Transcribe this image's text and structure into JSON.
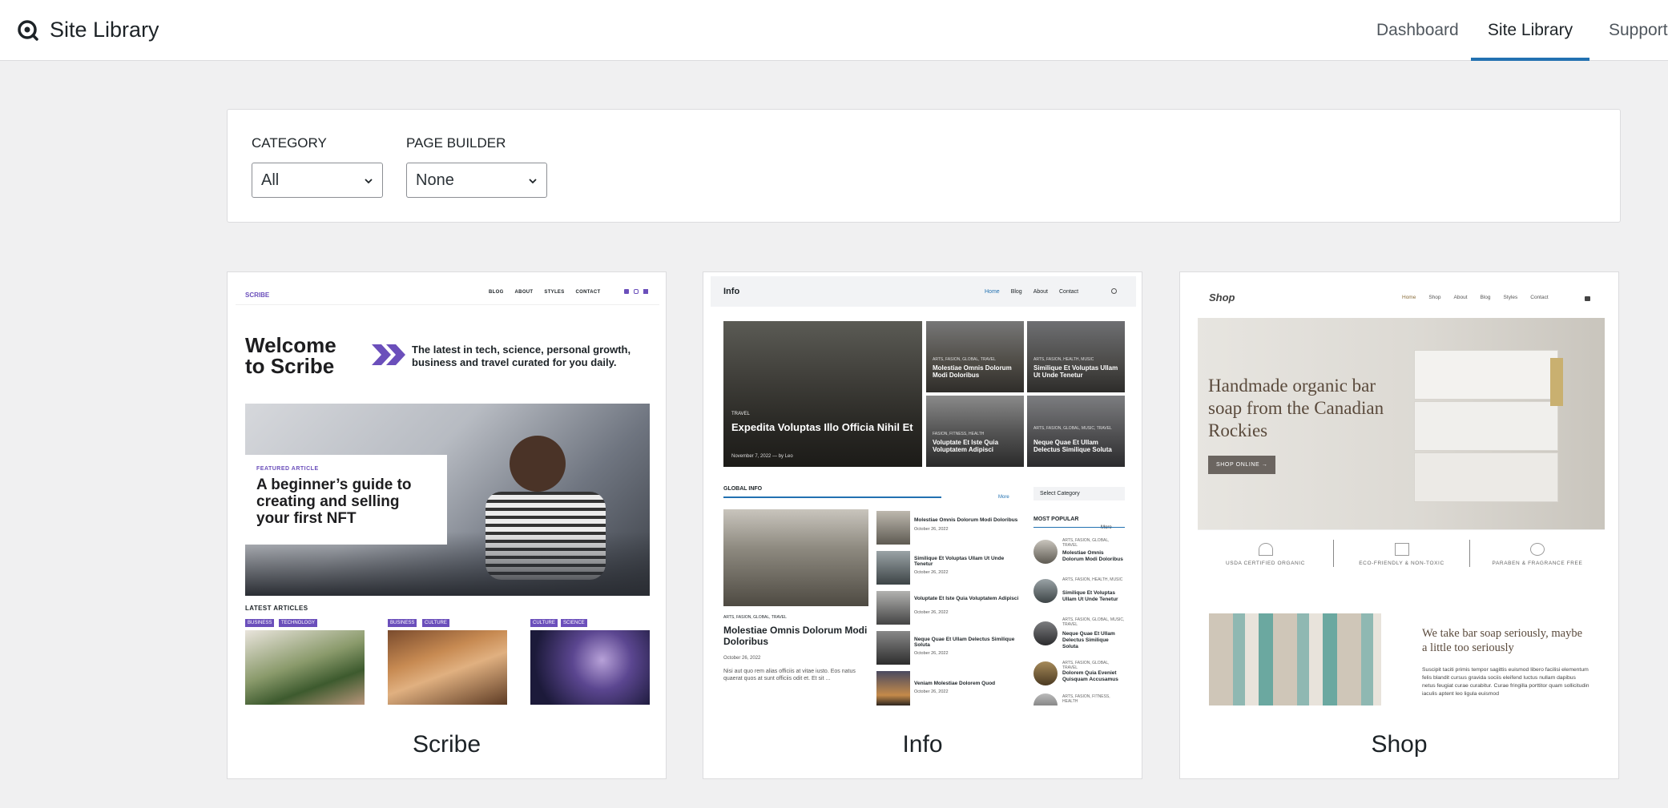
{
  "header": {
    "app_title": "Site Library",
    "logo_icon": "omega-logo-icon",
    "nav": [
      {
        "label": "Dashboard",
        "active": false
      },
      {
        "label": "Site Library",
        "active": true
      },
      {
        "label": "Support",
        "active": false
      }
    ],
    "accent_color": "#2271b1"
  },
  "filters": {
    "category": {
      "label": "CATEGORY",
      "value": "All"
    },
    "page_builder": {
      "label": "PAGE BUILDER",
      "value": "None"
    }
  },
  "templates": [
    {
      "name": "Scribe",
      "preview": {
        "brand": "SCRIBE",
        "nav": [
          "BLOG",
          "ABOUT",
          "STYLES",
          "CONTACT"
        ],
        "hero_title_1": "Welcome",
        "hero_title_2": "to Scribe",
        "hero_text": "The latest in tech, science, personal growth, business and travel curated for you daily.",
        "featured_label": "FEATURED ARTICLE",
        "featured_title": "A beginner’s guide to creating and selling your first NFT",
        "latest_label": "LATEST ARTICLES",
        "tags": [
          [
            "BUSINESS",
            "TECHNOLOGY"
          ],
          [
            "BUSINESS",
            "CULTURE"
          ],
          [
            "CULTURE",
            "SCIENCE"
          ]
        ]
      }
    },
    {
      "name": "Info",
      "preview": {
        "brand": "Info",
        "nav": [
          "Home",
          "Blog",
          "About",
          "Contact"
        ],
        "hero_cat": "TRAVEL",
        "hero_title": "Expedita Voluptas Illo Officia Nihil Et",
        "hero_meta": "November 7, 2022  —  by Leo",
        "tiles": [
          {
            "cat": "ARTS, FASION, GLOBAL, TRAVEL",
            "title": "Molestiae Omnis Dolorum Modi Doloribus"
          },
          {
            "cat": "ARTS, FASION, HEALTH, MUSIC",
            "title": "Similique Et Voluptas Ullam Ut Unde Tenetur"
          },
          {
            "cat": "FASION, FITNESS, HEALTH",
            "title": "Voluptate Et Iste Quia Voluptatem Adipisci"
          },
          {
            "cat": "ARTS, FASION, GLOBAL, MUSIC, TRAVEL",
            "title": "Neque Quae Et Ullam Delectus Similique Soluta"
          }
        ],
        "global_label": "GLOBAL INFO",
        "more": "More",
        "select_category": "Select Category",
        "main_cat": "ARTS, FASION, GLOBAL, TRAVEL",
        "main_title": "Molestiae Omnis Dolorum Modi Doloribus",
        "main_date": "October 26, 2022",
        "main_excerpt": "Nisi aut quo rem alias officiis at vitae iusto. Eos natus quaerat quos at sunt officiis odit et. Et sit ...",
        "list": [
          {
            "title": "Molestiae Omnis Dolorum Modi Doloribus",
            "date": "October 26, 2022"
          },
          {
            "title": "Similique Et Voluptas Ullam Ut Unde Tenetur",
            "date": "October 26, 2022"
          },
          {
            "title": "Voluptate Et Iste Quia Voluptatem Adipisci",
            "date": "October 26, 2022"
          },
          {
            "title": "Neque Quae Et Ullam Delectus Similique Soluta",
            "date": "October 26, 2022"
          },
          {
            "title": "Veniam Molestiae Dolorem Quod",
            "date": "October 26, 2022"
          }
        ],
        "popular_label": "MOST POPULAR",
        "popular": [
          {
            "cat": "ARTS, FASION, GLOBAL, TRAVEL",
            "title": "Molestiae Omnis Dolorum Modi Doloribus"
          },
          {
            "cat": "ARTS, FASION, HEALTH, MUSIC",
            "title": "Similique Et Voluptas Ullam Ut Unde Tenetur"
          },
          {
            "cat": "ARTS, FASION, GLOBAL, MUSIC, TRAVEL",
            "title": "Neque Quae Et Ullam Delectus Similique Soluta"
          },
          {
            "cat": "ARTS, FASION, GLOBAL, TRAVEL",
            "title": "Dolorem Quia Eveniet Quisquam Accusamus"
          },
          {
            "cat": "ARTS, FASION, FITNESS, HEALTH",
            "title": ""
          }
        ]
      }
    },
    {
      "name": "Shop",
      "preview": {
        "brand": "Shop",
        "nav": [
          "Home",
          "Shop",
          "About",
          "Blog",
          "Styles",
          "Contact"
        ],
        "hero_title": "Handmade organic bar soap from the Canadian Rockies",
        "cta": "SHOP ONLINE →",
        "features": [
          "USDA CERTIFIED ORGANIC",
          "ECO-FRIENDLY & NON-TOXIC",
          "PARABEN & FRAGRANCE FREE"
        ],
        "about_title": "We take bar soap seriously, maybe a little too seriously",
        "about_text": "Suscipit taciti primis tempor sagittis euismod libero facilisi elementum felis blandit cursus gravida sociis eleifend luctus nullam dapibus netus feugiat curae curabitur. Curae fringilla porttitor quam sollicitudin iaculis aptent leo ligula euismod"
      }
    }
  ]
}
